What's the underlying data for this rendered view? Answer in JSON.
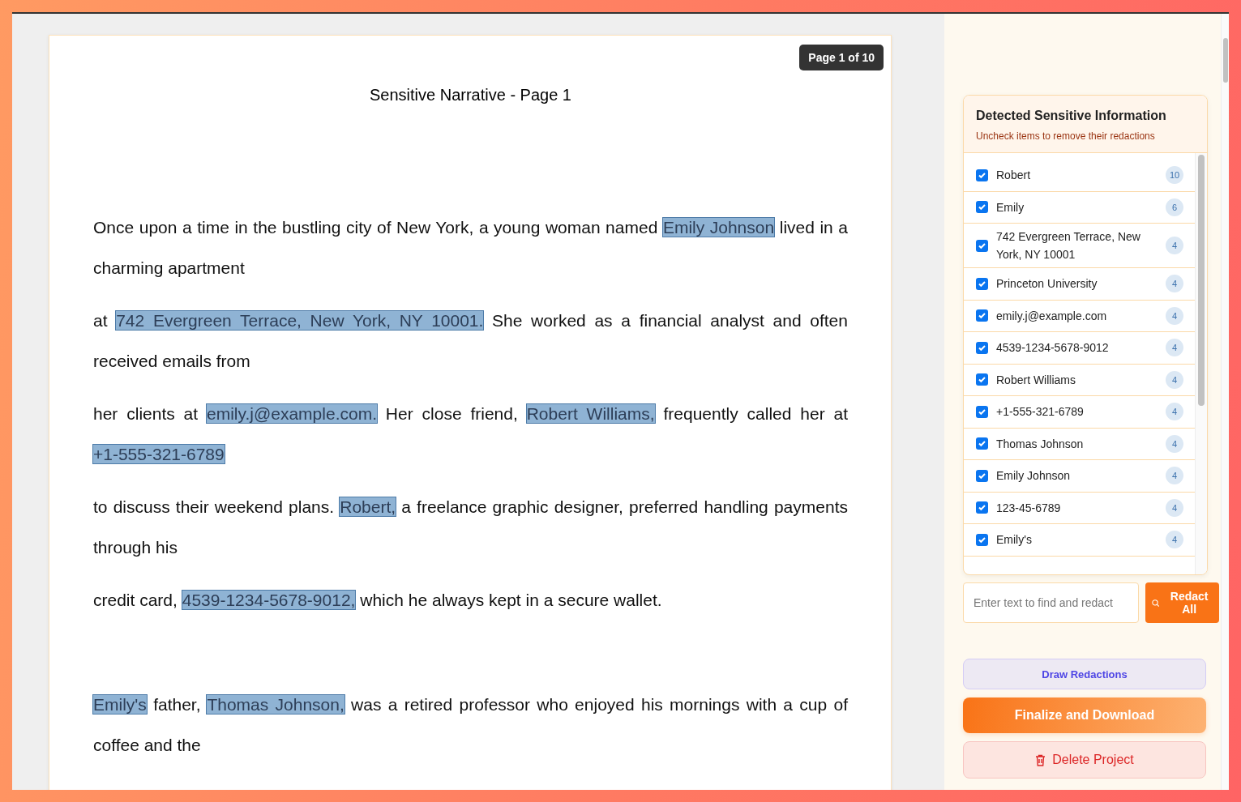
{
  "document": {
    "page_badge": "Page 1 of 10",
    "title": "Sensitive Narrative - Page 1",
    "paragraphs": [
      {
        "segments": [
          {
            "text": "Once upon a time in the bustling city of New York, a young woman named ",
            "redacted": false
          },
          {
            "text": "Emily Johnson",
            "redacted": true
          },
          {
            "text": " lived in a charming apartment",
            "redacted": false
          }
        ]
      },
      {
        "segments": [
          {
            "text": "at ",
            "redacted": false
          },
          {
            "text": "742 Evergreen Terrace, New York, NY 10001.",
            "redacted": true
          },
          {
            "text": " She worked as a financial analyst and often received emails from",
            "redacted": false
          }
        ]
      },
      {
        "segments": [
          {
            "text": "her clients at ",
            "redacted": false
          },
          {
            "text": "emily.j@example.com.",
            "redacted": true
          },
          {
            "text": " Her close friend, ",
            "redacted": false
          },
          {
            "text": "Robert Williams,",
            "redacted": true
          },
          {
            "text": " frequently called her at ",
            "redacted": false
          },
          {
            "text": "+1-555-321-6789",
            "redacted": true
          }
        ]
      },
      {
        "segments": [
          {
            "text": "to discuss their weekend plans. ",
            "redacted": false
          },
          {
            "text": "Robert,",
            "redacted": true
          },
          {
            "text": " a freelance graphic designer, preferred handling payments through his",
            "redacted": false
          }
        ]
      },
      {
        "segments": [
          {
            "text": "credit card, ",
            "redacted": false
          },
          {
            "text": "4539-1234-5678-9012,",
            "redacted": true
          },
          {
            "text": " which he always kept in a secure wallet.",
            "redacted": false
          }
        ]
      },
      {
        "section_break": true,
        "segments": [
          {
            "text": "Emily's",
            "redacted": true
          },
          {
            "text": " father, ",
            "redacted": false
          },
          {
            "text": "Thomas Johnson,",
            "redacted": true
          },
          {
            "text": " was a retired professor who enjoyed his mornings with a cup of coffee and the",
            "redacted": false
          }
        ]
      }
    ]
  },
  "panel": {
    "title": "Detected Sensitive Information",
    "subtitle": "Uncheck items to remove their redactions",
    "items": [
      {
        "label": "Robert",
        "count": "10",
        "checked": true
      },
      {
        "label": "Emily",
        "count": "6",
        "checked": true
      },
      {
        "label": "742 Evergreen Terrace, New York, NY 10001",
        "count": "4",
        "checked": true
      },
      {
        "label": "Princeton University",
        "count": "4",
        "checked": true
      },
      {
        "label": "emily.j@example.com",
        "count": "4",
        "checked": true
      },
      {
        "label": "4539-1234-5678-9012",
        "count": "4",
        "checked": true
      },
      {
        "label": "Robert Williams",
        "count": "4",
        "checked": true
      },
      {
        "label": "+1-555-321-6789",
        "count": "4",
        "checked": true
      },
      {
        "label": "Thomas Johnson",
        "count": "4",
        "checked": true
      },
      {
        "label": "Emily Johnson",
        "count": "4",
        "checked": true
      },
      {
        "label": "123-45-6789",
        "count": "4",
        "checked": true
      },
      {
        "label": "Emily's",
        "count": "4",
        "checked": true
      }
    ],
    "search": {
      "placeholder": "Enter text to find and redact"
    },
    "redact_all_button": "Redact All",
    "draw_button": "Draw Redactions",
    "finalize_button": "Finalize and Download",
    "delete_button": "Delete Project"
  }
}
